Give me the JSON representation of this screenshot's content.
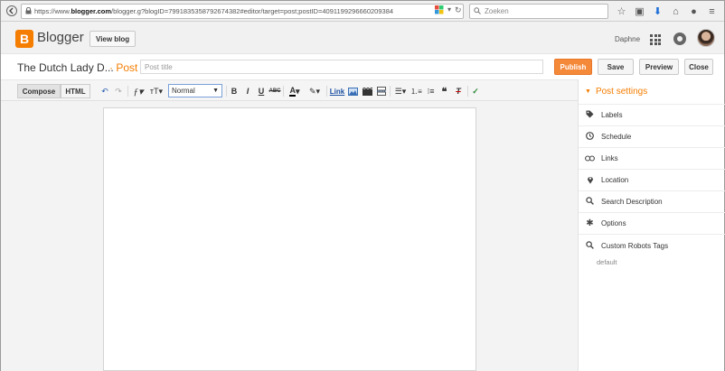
{
  "browser": {
    "url_prefix": "https://www.",
    "url_domain": "blogger.com",
    "url_rest": "/blogger.g?blogID=7991835358792674382#editor/target=post;postID=4091199296660209384",
    "search_placeholder": "Zoeken"
  },
  "header": {
    "logo_letter": "B",
    "app_name": "Blogger",
    "view_blog_label": "View blog",
    "user_name": "Daphne"
  },
  "titlebar": {
    "blog_title": "The Dutch Lady D...",
    "post_label": "· Post",
    "post_title_placeholder": "Post title",
    "publish_label": "Publish",
    "save_label": "Save",
    "preview_label": "Preview",
    "close_label": "Close"
  },
  "toolbar": {
    "compose_label": "Compose",
    "html_label": "HTML",
    "format_value": "Normal",
    "link_label": "Link"
  },
  "sidebar": {
    "title": "Post settings",
    "items": [
      {
        "label": "Labels",
        "icon": "tag-icon"
      },
      {
        "label": "Schedule",
        "icon": "clock-icon"
      },
      {
        "label": "Links",
        "icon": "link-icon"
      },
      {
        "label": "Location",
        "icon": "location-pin-icon"
      },
      {
        "label": "Search Description",
        "icon": "search-icon"
      },
      {
        "label": "Options",
        "icon": "gear-icon"
      },
      {
        "label": "Custom Robots Tags",
        "icon": "search-icon"
      }
    ],
    "robots_default": "default"
  },
  "colors": {
    "accent": "#f57d00",
    "publish_bg": "#f5893a"
  }
}
